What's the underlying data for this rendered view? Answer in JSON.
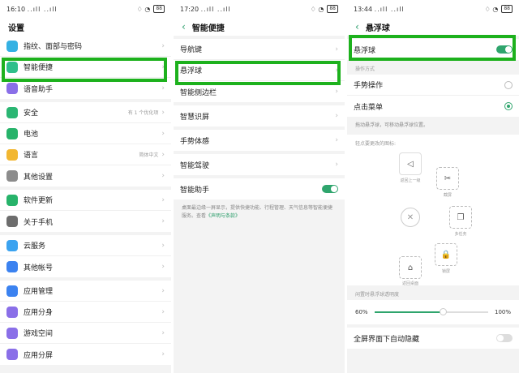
{
  "status": {
    "p1_time": "16:10",
    "p2_time": "17:20",
    "p3_time": "13:44",
    "signal": "..ıll ..ıll",
    "icons": "♢ ◔",
    "battery": "88"
  },
  "screen1": {
    "title": "设置",
    "groups": [
      [
        {
          "label": "指纹、面部与密码",
          "color": "#34b1e3"
        },
        {
          "label": "智能便捷",
          "color": "#2fbf8a"
        },
        {
          "label": "语音助手",
          "color": "#8a6fe8"
        }
      ],
      [
        {
          "label": "安全",
          "color": "#2bb673",
          "hint": "有 1 个优化项"
        },
        {
          "label": "电池",
          "color": "#27b36a"
        },
        {
          "label": "语言",
          "color": "#f2b731",
          "hint": "简体中文"
        },
        {
          "label": "其他设置",
          "color": "#8c8c8c"
        }
      ],
      [
        {
          "label": "软件更新",
          "color": "#27b36a"
        },
        {
          "label": "关于手机",
          "color": "#6d6d6d"
        }
      ],
      [
        {
          "label": "云服务",
          "color": "#3ba3f0"
        },
        {
          "label": "其他帐号",
          "color": "#3b82f0"
        }
      ],
      [
        {
          "label": "应用管理",
          "color": "#3b82f0"
        },
        {
          "label": "应用分身",
          "color": "#8a6fe8"
        },
        {
          "label": "游戏空间",
          "color": "#8a6fe8"
        },
        {
          "label": "应用分屏",
          "color": "#8a6fe8"
        }
      ]
    ]
  },
  "screen2": {
    "title": "智能便捷",
    "groups": [
      [
        "导航键",
        "悬浮球",
        "智能侧边栏"
      ],
      [
        "智慧识屏"
      ],
      [
        "手势体感"
      ],
      [
        "智能驾驶"
      ]
    ],
    "assistant_label": "智能助手",
    "assistant_on": true,
    "note": "桌面最边缘一屏显示，提供快捷功能、行程管理、天气信息等智能便捷服务。查看",
    "note_link": "《声明与条款》"
  },
  "screen3": {
    "title": "悬浮球",
    "main_toggle_label": "悬浮球",
    "main_toggle_on": true,
    "section_mode": "操作方式",
    "mode_gesture": "手势操作",
    "mode_menu": "点击菜单",
    "mode_selected": "点击菜单",
    "drag_hint": "拖动悬浮球，可移动悬浮球位置。",
    "icon_caption": "轻点要更改的图标:",
    "icons": {
      "back": "返回上一级",
      "screenshot": "截屏",
      "recents": "多任务",
      "lock": "锁屏",
      "home": "返回桌面"
    },
    "section_opacity": "闲置时悬浮球透明度",
    "opacity_min": "60%",
    "opacity_max": "100%",
    "opacity_value": 0.6,
    "fullscreen_label": "全屏界面下自动隐藏",
    "fullscreen_on": false
  }
}
